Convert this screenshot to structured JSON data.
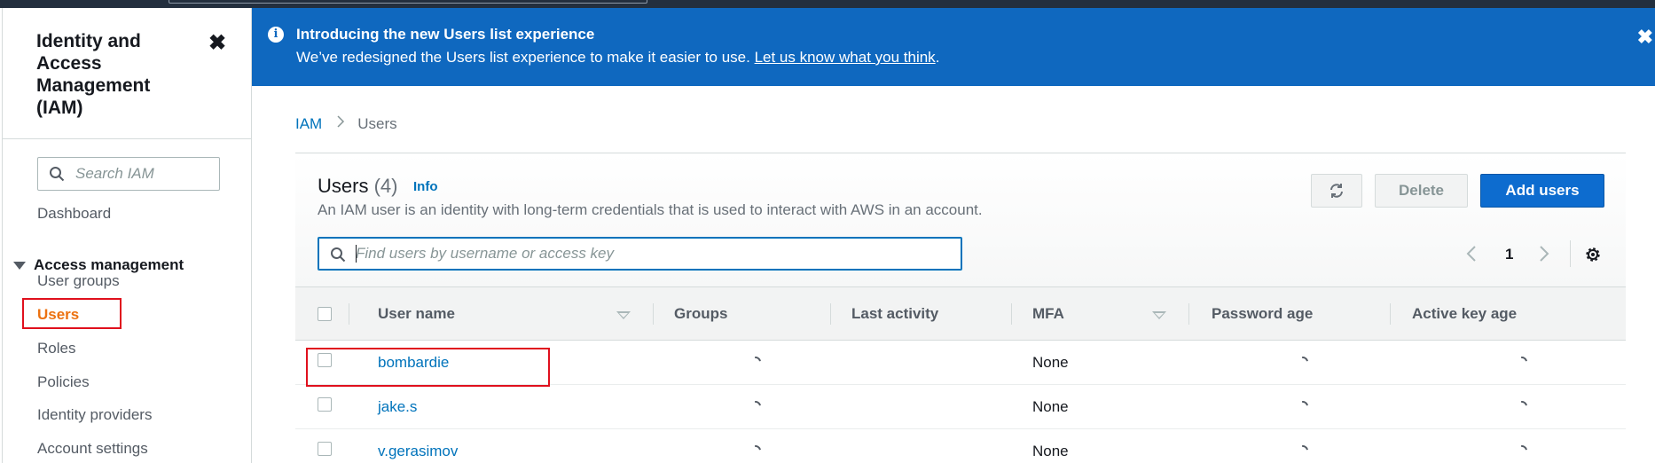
{
  "sidebar": {
    "title": "Identity and Access Management (IAM)",
    "search_placeholder": "Search IAM",
    "dashboard": "Dashboard",
    "section": "Access management",
    "items": [
      {
        "label": "User groups"
      },
      {
        "label": "Users",
        "active": true
      },
      {
        "label": "Roles"
      },
      {
        "label": "Policies"
      },
      {
        "label": "Identity providers"
      },
      {
        "label": "Account settings"
      }
    ]
  },
  "banner": {
    "title": "Introducing the new Users list experience",
    "text": "We’ve redesigned the Users list experience to make it easier to use.",
    "link": "Let us know what you think",
    "trailing": "."
  },
  "breadcrumb": {
    "root": "IAM",
    "current": "Users"
  },
  "users": {
    "title": "Users",
    "count": "(4)",
    "info": "Info",
    "description": "An IAM user is an identity with long-term credentials that is used to interact with AWS in an account.",
    "delete_label": "Delete",
    "add_label": "Add users",
    "filter_placeholder": "Find users by username or access key",
    "page": "1",
    "columns": [
      "User name",
      "Groups",
      "Last activity",
      "MFA",
      "Password age",
      "Active key age"
    ],
    "rows": [
      {
        "name": "bombardie",
        "mfa": "None"
      },
      {
        "name": "jake.s",
        "mfa": "None"
      },
      {
        "name": "v.gerasimov",
        "mfa": "None"
      }
    ]
  },
  "colors": {
    "accent": "#0073bb",
    "banner": "#0f68bf",
    "primary_button": "#0d6ccf",
    "active_nav": "#ec7211",
    "highlight_box": "#e0101d"
  },
  "icons": [
    "close-icon",
    "search-icon",
    "caret-down-icon",
    "info-icon",
    "refresh-icon",
    "chevron-left-icon",
    "chevron-right-icon",
    "gear-icon",
    "sort-icon",
    "loading-spinner-icon"
  ]
}
